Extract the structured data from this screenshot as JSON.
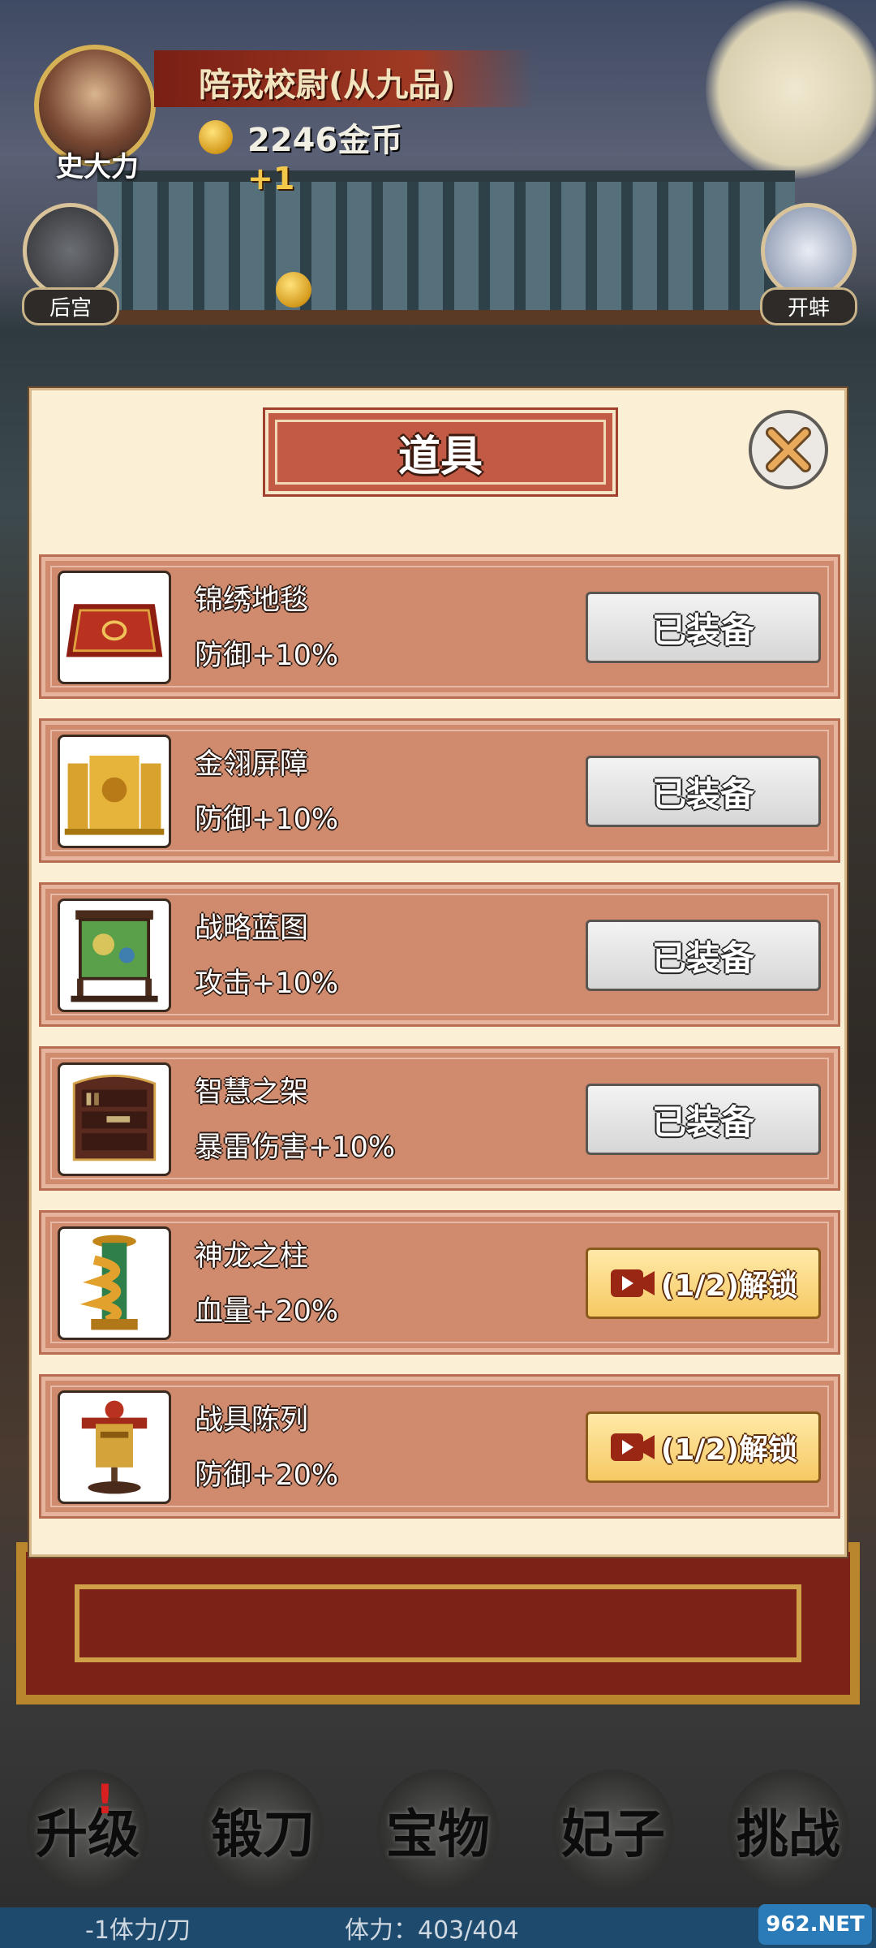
{
  "player": {
    "name": "史大力",
    "rank": "陪戎校尉(从九品)",
    "gold": "2246金币",
    "gold_gain": "+1"
  },
  "side_buttons": {
    "harem": "后宫",
    "open_clam": "开蚌"
  },
  "modal": {
    "title": "道具",
    "close_icon": "close-icon",
    "items": [
      {
        "name": "锦绣地毯",
        "effect": "防御+10%",
        "button": "已装备",
        "state": "equipped",
        "icon": "carpet-icon"
      },
      {
        "name": "金翎屏障",
        "effect": "防御+10%",
        "button": "已装备",
        "state": "equipped",
        "icon": "screen-icon"
      },
      {
        "name": "战略蓝图",
        "effect": "攻击+10%",
        "button": "已装备",
        "state": "equipped",
        "icon": "map-stand-icon"
      },
      {
        "name": "智慧之架",
        "effect": "暴雷伤害+10%",
        "button": "已装备",
        "state": "equipped",
        "icon": "bookshelf-icon"
      },
      {
        "name": "神龙之柱",
        "effect": "血量+20%",
        "button": "(1/2)解锁",
        "state": "locked",
        "icon": "dragon-pillar-icon"
      },
      {
        "name": "战具陈列",
        "effect": "防御+20%",
        "button": "(1/2)解锁",
        "state": "locked",
        "icon": "armor-stand-icon"
      }
    ]
  },
  "bottom_nav": {
    "upgrade": "升级",
    "forge": "锻刀",
    "treasure": "宝物",
    "consort": "妃子",
    "challenge": "挑战",
    "upgrade_badge": "!"
  },
  "status": {
    "cost": "-1体力/刀",
    "stamina": "体力：403/404"
  },
  "watermark": "962.NET",
  "colors": {
    "panel": "#fbefd6",
    "item_bg": "#d08a6d",
    "title_bg": "#c35a45",
    "unlock_btn": "#f6c963",
    "equipped_btn": "#d6d6d6"
  }
}
